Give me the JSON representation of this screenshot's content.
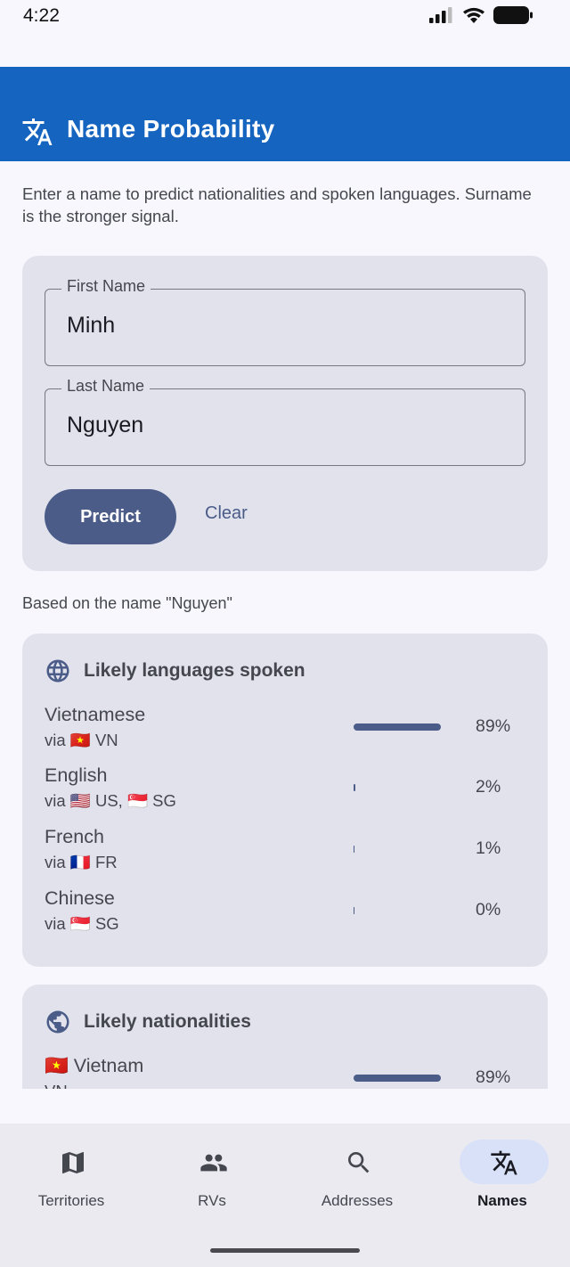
{
  "status_bar": {
    "time": "4:22"
  },
  "app_bar": {
    "title": "Name Probability",
    "icon": "translate-icon"
  },
  "intro_text": "Enter a name to predict nationalities and spoken languages. Surname is the stronger signal.",
  "form": {
    "first_name_label": "First Name",
    "first_name_value": "Minh",
    "last_name_label": "Last Name",
    "last_name_value": "Nguyen",
    "predict_label": "Predict",
    "clear_label": "Clear"
  },
  "basis_text": "Based on the name \"Nguyen\"",
  "languages": {
    "title": "Likely languages spoken",
    "icon": "globe-icon",
    "items": [
      {
        "name": "Vietnamese",
        "via": "via 🇻🇳 VN",
        "percent": 89,
        "label": "89%"
      },
      {
        "name": "English",
        "via": "via 🇺🇸 US, 🇸🇬 SG",
        "percent": 2,
        "label": "2%"
      },
      {
        "name": "French",
        "via": "via 🇫🇷 FR",
        "percent": 1,
        "label": "1%"
      },
      {
        "name": "Chinese",
        "via": "via 🇸🇬 SG",
        "percent": 0.3,
        "label": "0%"
      }
    ]
  },
  "nationalities": {
    "title": "Likely nationalities",
    "icon": "public-icon",
    "items": [
      {
        "name": "🇻🇳 Vietnam",
        "code": "VN",
        "percent": 89,
        "label": "89%"
      }
    ]
  },
  "nav": {
    "items": [
      {
        "label": "Territories",
        "icon": "map-icon",
        "active": false
      },
      {
        "label": "RVs",
        "icon": "people-icon",
        "active": false
      },
      {
        "label": "Addresses",
        "icon": "search-icon",
        "active": false
      },
      {
        "label": "Names",
        "icon": "translate-icon",
        "active": true
      }
    ]
  },
  "colors": {
    "app_bar": "#1565c0",
    "primary": "#4b5c89",
    "card": "#e1e2ec",
    "background": "#f8f7fd",
    "active_pill": "#d9e1f9"
  }
}
